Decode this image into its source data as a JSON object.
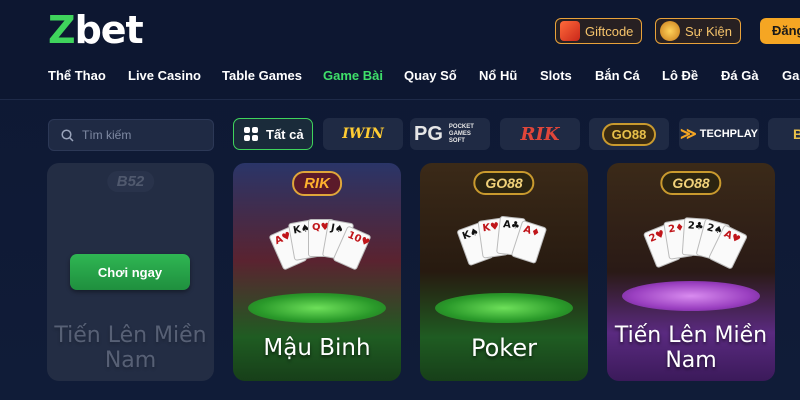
{
  "brand": {
    "logo_first": "Z",
    "logo_rest": "bet"
  },
  "header_actions": {
    "giftcode": "Giftcode",
    "event": "Sự Kiện",
    "login": "Đăng"
  },
  "nav": [
    {
      "label": "Thể Thao"
    },
    {
      "label": "Live Casino"
    },
    {
      "label": "Table Games"
    },
    {
      "label": "Game Bài",
      "active": true
    },
    {
      "label": "Quay Số"
    },
    {
      "label": "Nổ Hũ"
    },
    {
      "label": "Slots"
    },
    {
      "label": "Bắn Cá"
    },
    {
      "label": "Lô Đề"
    },
    {
      "label": "Đá Gà"
    },
    {
      "label": "Ga"
    }
  ],
  "filters": {
    "search_placeholder": "Tìm kiếm",
    "all_label": "Tất cả",
    "providers": [
      {
        "name": "IWIN"
      },
      {
        "name": "PG",
        "sub": "POCKET GAMES SOFT"
      },
      {
        "name": "RIK"
      },
      {
        "name": "GO88"
      },
      {
        "name": "TECHPLAY",
        "mark": "≫"
      },
      {
        "name": "B"
      }
    ]
  },
  "games": [
    {
      "provider": "B52",
      "title": "Tiến Lên Miền Nam",
      "play_label": "Chơi ngay"
    },
    {
      "provider": "RIK",
      "title": "Mậu Binh"
    },
    {
      "provider": "GO88",
      "title": "Poker"
    },
    {
      "provider": "GO88",
      "title": "Tiến Lên Miền Nam"
    }
  ],
  "colors": {
    "accent_green": "#3fd45c",
    "gold": "#e8a23a",
    "background": "#0f1a33"
  },
  "icons": [
    "gift-icon",
    "trophy-icon",
    "search-icon",
    "grid-icon"
  ]
}
